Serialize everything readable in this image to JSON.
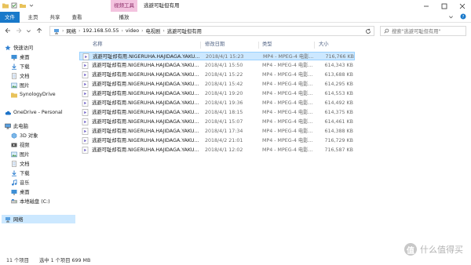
{
  "window": {
    "context_tab": "视频工具",
    "title": "逃避可耻但有用"
  },
  "ribbon": {
    "tabs": {
      "file": "文件",
      "home": "主页",
      "share": "共享",
      "view": "查看",
      "manage": "播放"
    }
  },
  "address": {
    "crumbs": [
      "网络",
      "192.168.50.55",
      "video",
      "电视剧",
      "逃避可耻但有用"
    ],
    "search_placeholder": "搜索\"逃避可耻但有用\""
  },
  "sidebar": {
    "items": [
      {
        "label": "快速访问",
        "icon": "star-icon",
        "pinned": false
      },
      {
        "label": "桌面",
        "icon": "desktop-icon",
        "pinned": true
      },
      {
        "label": "下载",
        "icon": "download-icon",
        "pinned": true
      },
      {
        "label": "文档",
        "icon": "document-icon",
        "pinned": true
      },
      {
        "label": "图片",
        "icon": "picture-icon",
        "pinned": true
      },
      {
        "label": "SynologyDrive",
        "icon": "folder-icon",
        "pinned": true
      },
      {
        "label": "OneDrive - Personal",
        "icon": "cloud-icon",
        "pinned": false
      },
      {
        "label": "此电脑",
        "icon": "computer-icon",
        "pinned": false
      },
      {
        "label": "3D 对象",
        "icon": "cube-icon",
        "pinned": false
      },
      {
        "label": "视频",
        "icon": "video-icon",
        "pinned": false
      },
      {
        "label": "图片",
        "icon": "picture-icon",
        "pinned": false
      },
      {
        "label": "文档",
        "icon": "document-icon",
        "pinned": false
      },
      {
        "label": "下载",
        "icon": "download-icon",
        "pinned": false
      },
      {
        "label": "音乐",
        "icon": "music-icon",
        "pinned": false
      },
      {
        "label": "桌面",
        "icon": "desktop-icon",
        "pinned": false
      },
      {
        "label": "本地磁盘 (C:)",
        "icon": "disk-icon",
        "pinned": false
      },
      {
        "label": "网络",
        "icon": "network-icon",
        "pinned": false
      }
    ]
  },
  "columns": {
    "name": "名称",
    "date": "修改日期",
    "type": "类型",
    "size": "大小"
  },
  "files": [
    {
      "name": "逃避可耻却有用.NIGERUHA.HAJIDAGA.YAKU...",
      "date": "2018/4/1 15:23",
      "type": "MP4 - MPEG-4 电影...",
      "size": "716,766 KB"
    },
    {
      "name": "逃避可耻却有用.NIGERUHA.HAJIDAGA.YAKU...",
      "date": "2018/4/1 15:50",
      "type": "MP4 - MPEG-4 电影...",
      "size": "614,343 KB"
    },
    {
      "name": "逃避可耻却有用.NIGERUHA.HAJIDAGA.YAKU...",
      "date": "2018/4/1 15:22",
      "type": "MP4 - MPEG-4 电影...",
      "size": "613,688 KB"
    },
    {
      "name": "逃避可耻却有用.NIGERUHA.HAJIDAGA.YAKU...",
      "date": "2018/4/1 15:42",
      "type": "MP4 - MPEG-4 电影...",
      "size": "614,295 KB"
    },
    {
      "name": "逃避可耻却有用.NIGERUHA.HAJIDAGA.YAKU...",
      "date": "2018/4/1 19:20",
      "type": "MP4 - MPEG-4 电影...",
      "size": "614,553 KB"
    },
    {
      "name": "逃避可耻却有用.NIGERUHA.HAJIDAGA.YAKU...",
      "date": "2018/4/1 19:36",
      "type": "MP4 - MPEG-4 电影...",
      "size": "614,492 KB"
    },
    {
      "name": "逃避可耻却有用.NIGERUHA.HAJIDAGA.YAKU...",
      "date": "2018/4/1 18:15",
      "type": "MP4 - MPEG-4 电影...",
      "size": "614,375 KB"
    },
    {
      "name": "逃避可耻却有用.NIGERUHA.HAJIDAGA.YAKU...",
      "date": "2018/4/1 15:07",
      "type": "MP4 - MPEG-4 电影...",
      "size": "614,461 KB"
    },
    {
      "name": "逃避可耻却有用.NIGERUHA.HAJIDAGA.YAKU...",
      "date": "2018/4/1 17:34",
      "type": "MP4 - MPEG-4 电影...",
      "size": "614,388 KB"
    },
    {
      "name": "逃避可耻却有用.NIGERUHA.HAJIDAGA.YAKU...",
      "date": "2018/4/2 21:01",
      "type": "MP4 - MPEG-4 电影...",
      "size": "716,729 KB"
    },
    {
      "name": "逃避可耻却有用.NIGERUHA.HAJIDAGA.YAKU...",
      "date": "2018/4/1 12:02",
      "type": "MP4 - MPEG-4 电影...",
      "size": "716,587 KB"
    }
  ],
  "status": {
    "count": "11 个项目",
    "selection": "选中 1 个项目  699 MB"
  },
  "watermark": {
    "mark": "值",
    "text": "什么值得买"
  },
  "colors": {
    "accent": "#1979ca",
    "selection": "#cce8ff",
    "context_tab": "#f3c3df"
  }
}
